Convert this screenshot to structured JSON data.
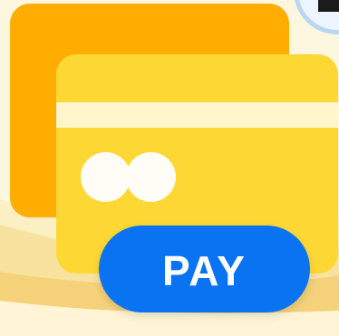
{
  "illustration": {
    "pay_button_label": "PAY",
    "icons": {
      "back_card": "credit-card-icon",
      "front_card": "credit-card-icon",
      "corner_badge": "partial-badge-icon"
    }
  },
  "colors": {
    "background": "#fdf7df",
    "back_card": "#ffad00",
    "front_card": "#fdd835",
    "stripe": "#fff6cc",
    "pay_button": "#0a73f2",
    "pay_text": "#ffffff"
  }
}
